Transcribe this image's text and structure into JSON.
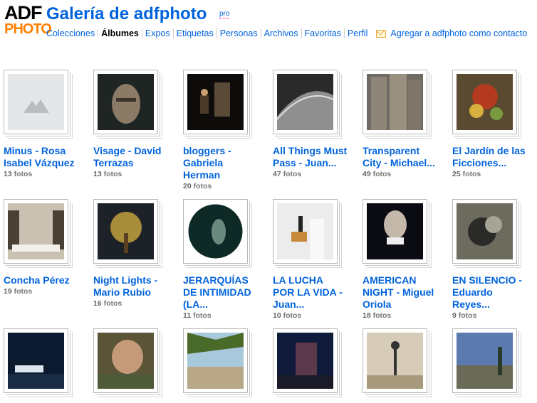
{
  "logo": {
    "line1": "ADF",
    "line2": "PHOTO"
  },
  "header": {
    "title": "Galería de adfphoto",
    "badge": "pro"
  },
  "nav": {
    "items": [
      {
        "label": "Colecciones",
        "active": false
      },
      {
        "label": "Álbumes",
        "active": true
      },
      {
        "label": "Expos",
        "active": false
      },
      {
        "label": "Etiquetas",
        "active": false
      },
      {
        "label": "Personas",
        "active": false
      },
      {
        "label": "Archivos",
        "active": false
      },
      {
        "label": "Favoritas",
        "active": false
      },
      {
        "label": "Perfil",
        "active": false
      }
    ],
    "mail_icon": "envelope-icon",
    "add_contact": "Agregar a adfphoto como contacto"
  },
  "count_suffix": "fotos",
  "albums": [
    {
      "title_lines": [
        "Minus - Rosa",
        "Isabel Vázquez"
      ],
      "count": "13"
    },
    {
      "title_lines": [
        "Visage - David",
        "Terrazas"
      ],
      "count": "13"
    },
    {
      "title_lines": [
        "bloggers -",
        "Gabriela",
        "Herman"
      ],
      "count": "20"
    },
    {
      "title_lines": [
        "All Things Must",
        "Pass - Juan..."
      ],
      "count": "47"
    },
    {
      "title_lines": [
        "Transparent",
        "City - Michael..."
      ],
      "count": "49"
    },
    {
      "title_lines": [
        "El Jardín de las",
        "Ficciones..."
      ],
      "count": "25"
    },
    {
      "title_lines": [
        "Concha Pérez"
      ],
      "count": "19"
    },
    {
      "title_lines": [
        "Night Lights -",
        "Mario Rubio"
      ],
      "count": "16"
    },
    {
      "title_lines": [
        "JERARQUÍAS",
        "DE INTIMIDAD",
        "(LA..."
      ],
      "count": "11"
    },
    {
      "title_lines": [
        "LA LUCHA",
        "POR LA VIDA -",
        "Juan..."
      ],
      "count": "10"
    },
    {
      "title_lines": [
        "AMERICAN",
        "NIGHT - Miguel",
        "Oriola"
      ],
      "count": "18"
    },
    {
      "title_lines": [
        "EN SILENCIO -",
        "Eduardo",
        "Reyes..."
      ],
      "count": "9"
    },
    {
      "title_lines": [],
      "count": ""
    },
    {
      "title_lines": [],
      "count": ""
    },
    {
      "title_lines": [],
      "count": ""
    },
    {
      "title_lines": [],
      "count": ""
    },
    {
      "title_lines": [],
      "count": ""
    },
    {
      "title_lines": [],
      "count": ""
    }
  ]
}
